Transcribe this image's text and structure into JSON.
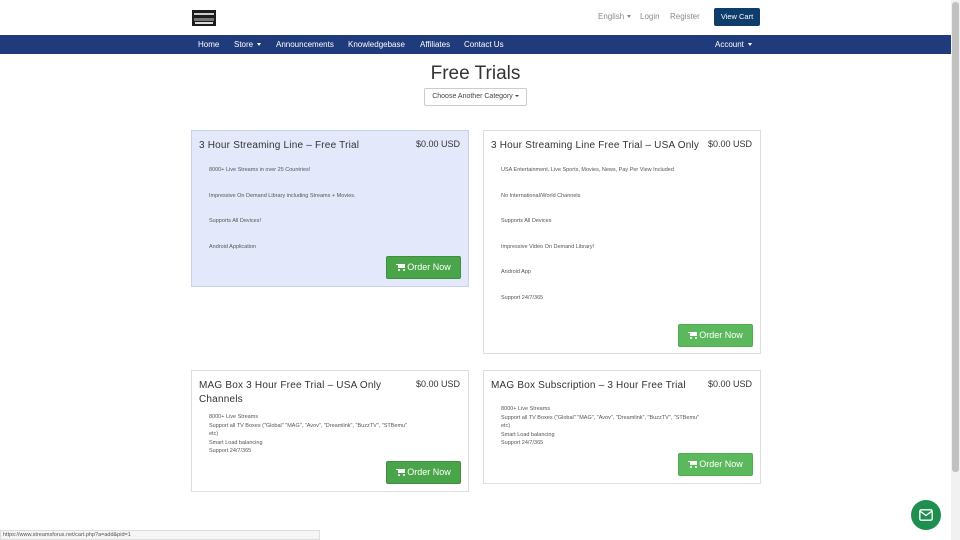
{
  "header": {
    "language": "English",
    "login": "Login",
    "register": "Register",
    "view_cart": "View Cart"
  },
  "nav": {
    "items": [
      "Home",
      "Store",
      "Announcements",
      "Knowledgebase",
      "Affiliates",
      "Contact Us"
    ],
    "account": "Account"
  },
  "page": {
    "title": "Free Trials",
    "category_dropdown": "Choose Another Category"
  },
  "products": [
    {
      "title": "3 Hour Streaming Line – Free Trial",
      "price": "$0.00 USD",
      "features": [
        "8000+ Live Streams in over 25 Countries!",
        "Impressive On Demand Library including Streams + Movies.",
        "Supports All Devices!",
        "Android Application"
      ],
      "button": "Order Now"
    },
    {
      "title": "3 Hour Streaming Line Free Trial – USA Only",
      "price": "$0.00 USD",
      "features": [
        "USA Entertainment, Live Sports, Movies, News, Pay Per View Included",
        "No International/World Channels",
        "Supports All Devices",
        "Impressive Video On Demand Library!",
        "Android App",
        "Support 24/7/365"
      ],
      "button": "Order Now"
    },
    {
      "title_line1": "MAG Box 3 Hour Free Trial – USA Only",
      "title_line2": "Channels",
      "price": "$0.00 USD",
      "features": [
        "8000+ Live Streams",
        "Support all TV Boxes (\"Global\" \"MAG\", \"Avov\", \"Dreamlink\", \"BuzzTV\", \"STBemu\"",
        "etc)",
        "Smart Load balancing",
        "Support 24/7/365"
      ],
      "button": "Order Now"
    },
    {
      "title": "MAG Box Subscription – 3 Hour Free Trial",
      "price": "$0.00 USD",
      "features": [
        "8000+ Live Streams",
        "Support all TV Boxes (\"Global\" \"MAG\", \"Avov\", \"Dreamlink\", \"BuzzTV\", \"STBemu\"",
        "etc)",
        "Smart Load balancing",
        "Support 24/7/365"
      ],
      "button": "Order Now"
    }
  ],
  "status_url": "https://www.streamsforus.net/cart.php?a=add&pid=1",
  "icons": {
    "cart": "shopping-cart-icon",
    "chat": "envelope-icon"
  },
  "colors": {
    "nav": "#1f3b7b",
    "cart_button": "#0e3d6c",
    "order_button": "#4aa54a",
    "featured_card": "#e3e9fb",
    "chat": "#1f8f4f"
  }
}
